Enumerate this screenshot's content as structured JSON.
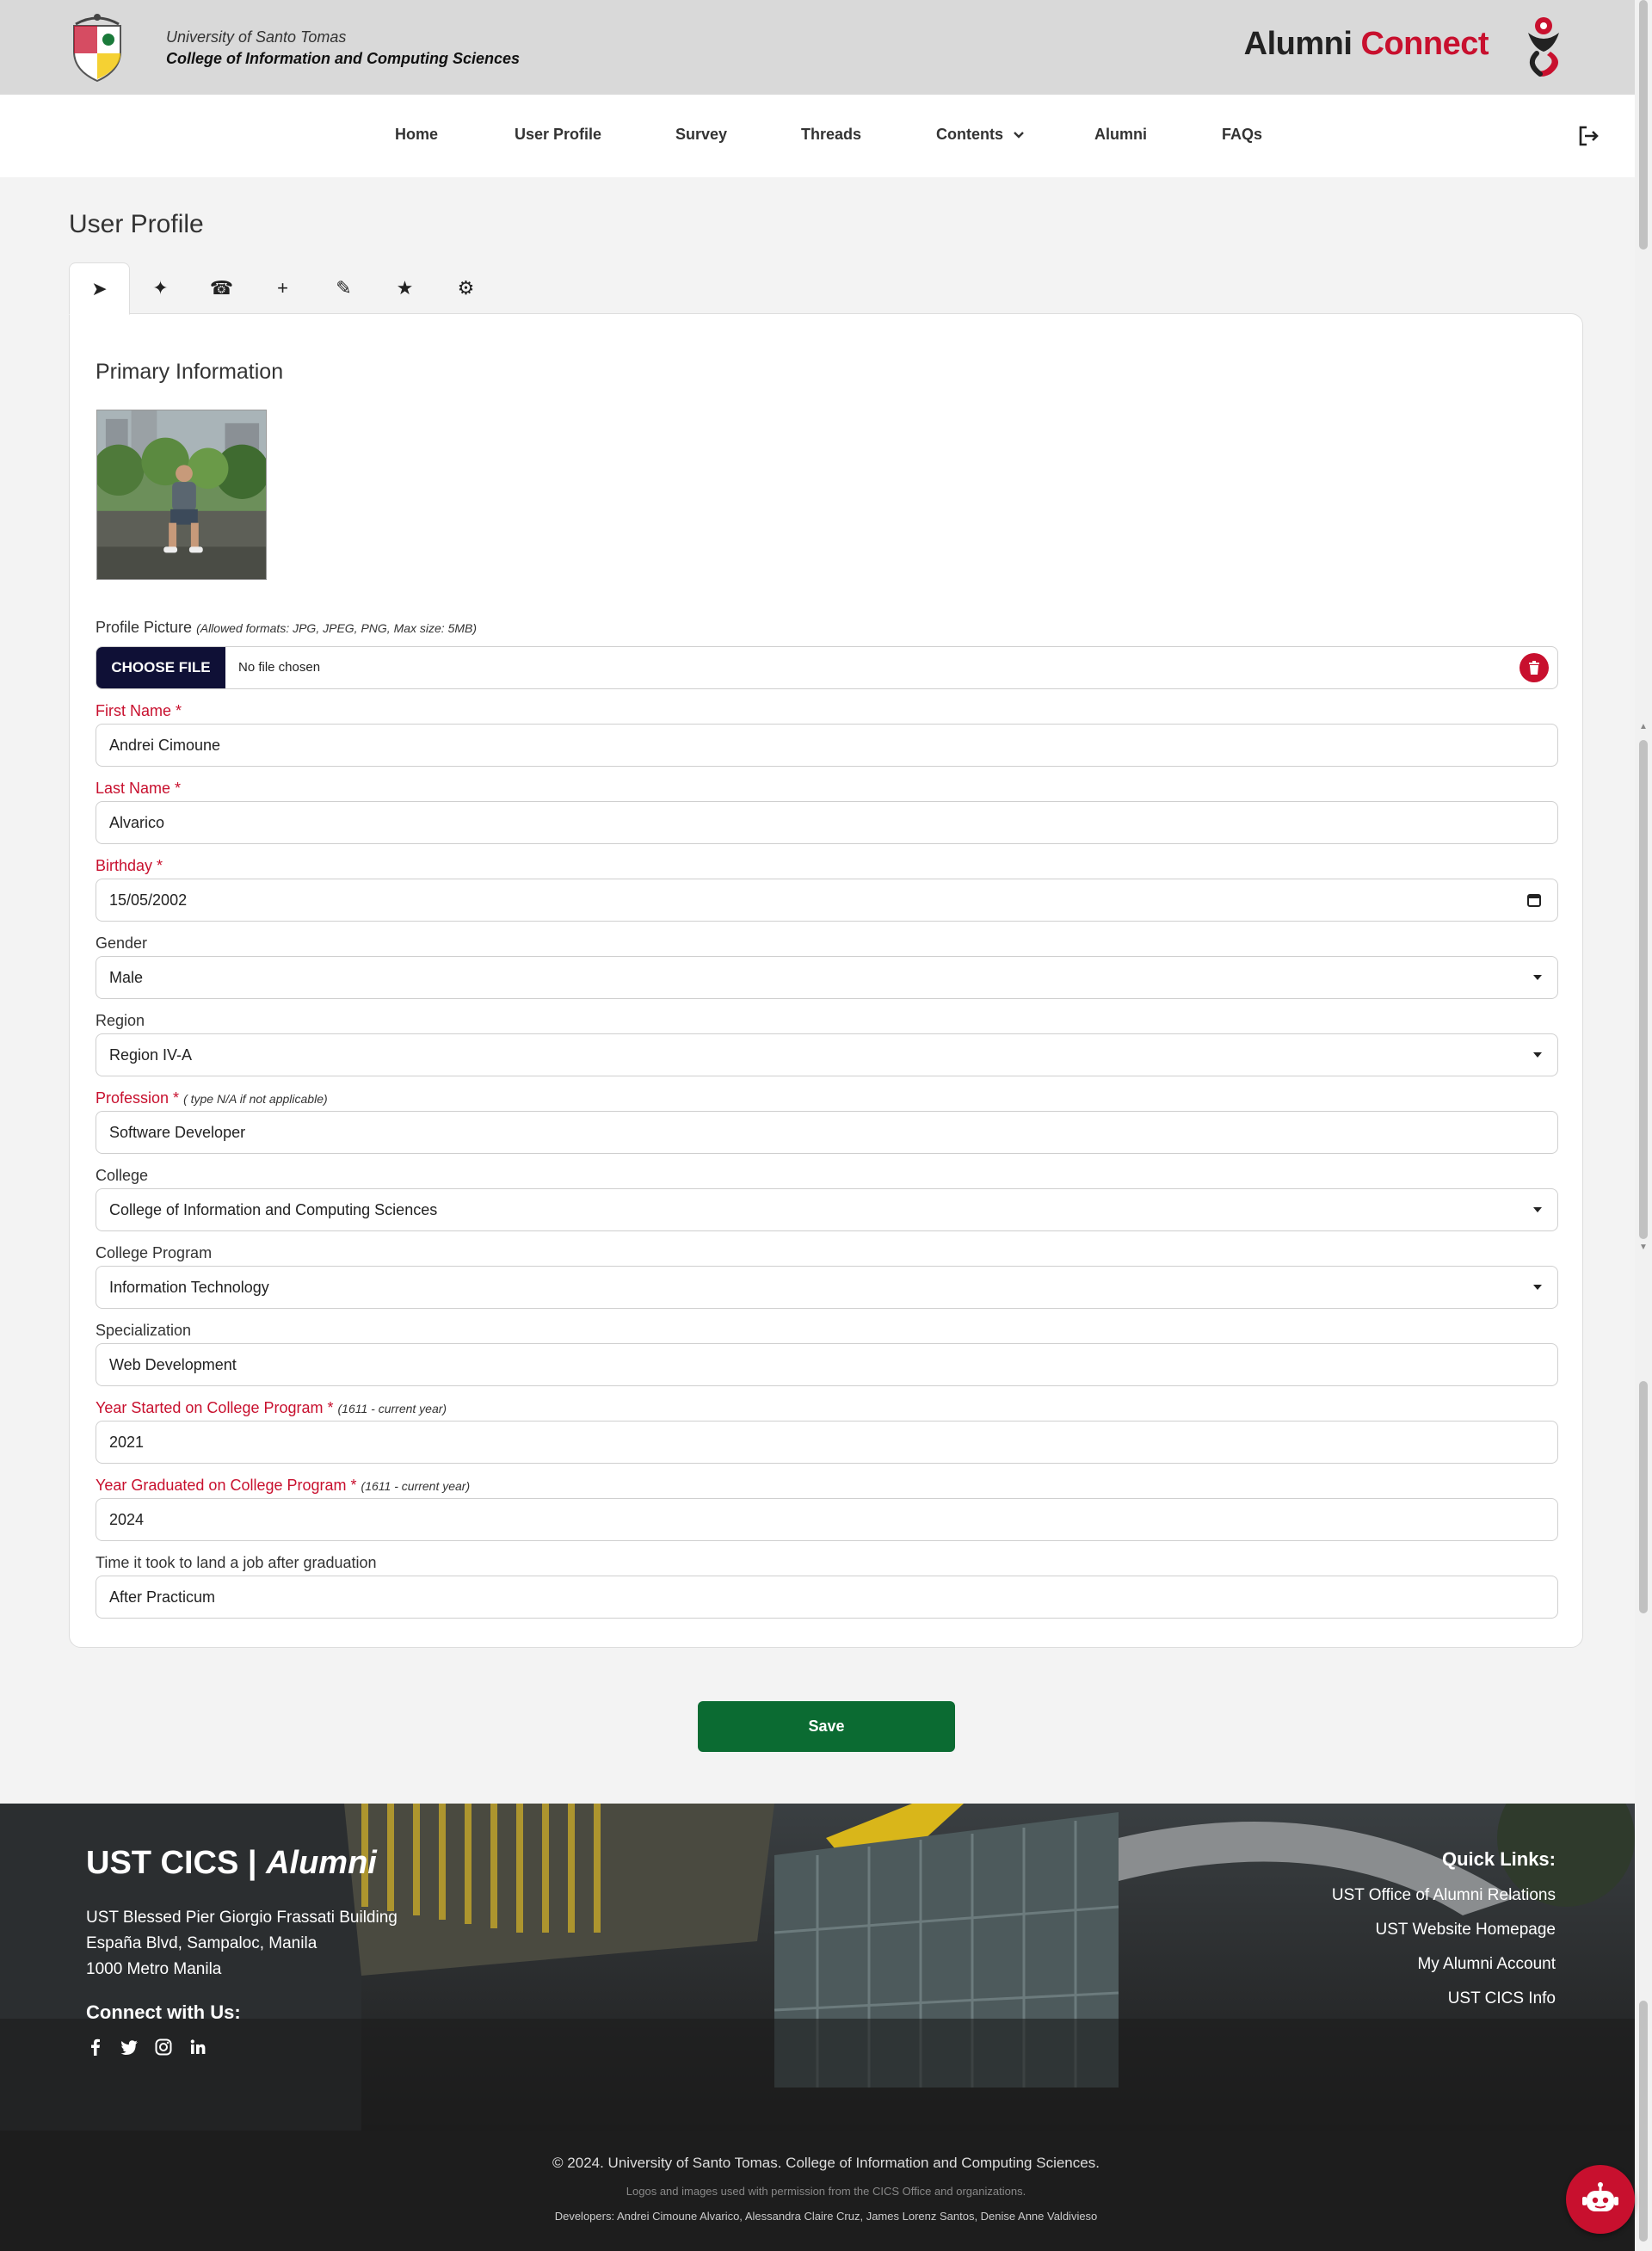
{
  "header": {
    "university": "University of Santo Tomas",
    "college": "College of Information and Computing Sciences",
    "brand_part1": "Alumni",
    "brand_part2": "Connect",
    "brand_color": "#c8102e"
  },
  "nav": {
    "items": [
      {
        "label": "Home"
      },
      {
        "label": "User Profile"
      },
      {
        "label": "Survey"
      },
      {
        "label": "Threads"
      },
      {
        "label": "Contents"
      },
      {
        "label": "Alumni"
      },
      {
        "label": "FAQs"
      }
    ],
    "logout_icon": "logout-icon"
  },
  "page": {
    "title": "User Profile",
    "tabs": [
      {
        "icon": "paper-plane-icon",
        "glyph": "➤"
      },
      {
        "icon": "sparkle-icon",
        "glyph": "✦"
      },
      {
        "icon": "phone-icon",
        "glyph": "☎"
      },
      {
        "icon": "plus-icon",
        "glyph": "+"
      },
      {
        "icon": "pencil-icon",
        "glyph": "✎"
      },
      {
        "icon": "star-icon",
        "glyph": "★"
      },
      {
        "icon": "settings-icon",
        "glyph": "⚙"
      }
    ],
    "section_title": "Primary Information"
  },
  "form": {
    "profile_picture": {
      "label": "Profile Picture",
      "note": "(Allowed formats: JPG, JPEG, PNG, Max size: 5MB)",
      "button": "CHOOSE FILE",
      "file_status": "No file chosen"
    },
    "first_name": {
      "label": "First Name *",
      "value": "Andrei Cimoune"
    },
    "last_name": {
      "label": "Last Name *",
      "value": "Alvarico"
    },
    "birthday": {
      "label": "Birthday *",
      "value": "15/05/2002"
    },
    "gender": {
      "label": "Gender",
      "value": "Male"
    },
    "region": {
      "label": "Region",
      "value": "Region IV-A"
    },
    "profession": {
      "label": "Profession *",
      "note": "( type N/A if not applicable)",
      "value": "Software Developer"
    },
    "college": {
      "label": "College",
      "value": "College of Information and Computing Sciences"
    },
    "program": {
      "label": "College Program",
      "value": "Information Technology"
    },
    "specialization": {
      "label": "Specialization",
      "value": "Web Development"
    },
    "year_started": {
      "label": "Year Started on College Program *",
      "note": "(1611 - current year)",
      "value": "2021"
    },
    "year_graduated": {
      "label": "Year Graduated on College Program *",
      "note": "(1611 - current year)",
      "value": "2024"
    },
    "time_to_job": {
      "label": "Time it took to land a job after graduation",
      "value": "After Practicum"
    },
    "save_label": "Save",
    "save_color": "#0b6b32"
  },
  "footer": {
    "title_part1": "UST CICS | ",
    "title_part2": "Alumni",
    "address": [
      "UST Blessed Pier Giorgio Frassati Building",
      "España Blvd, Sampaloc, Manila",
      "1000 Metro Manila"
    ],
    "connect": "Connect with Us:",
    "social_icons": [
      "facebook-icon",
      "twitter-icon",
      "instagram-icon",
      "linkedin-icon"
    ],
    "quick_links_title": "Quick Links:",
    "quick_links": [
      "UST Office of Alumni Relations",
      "UST Website Homepage",
      "My Alumni Account",
      "UST CICS Info"
    ],
    "copyright": "© 2024. University of Santo Tomas. College of Information and Computing Sciences.",
    "permission": "Logos and images used with permission from the CICS Office and organizations.",
    "developers": "Developers: Andrei Cimoune Alvarico, Alessandra Claire Cruz, James Lorenz Santos, Denise Anne Valdivieso"
  }
}
